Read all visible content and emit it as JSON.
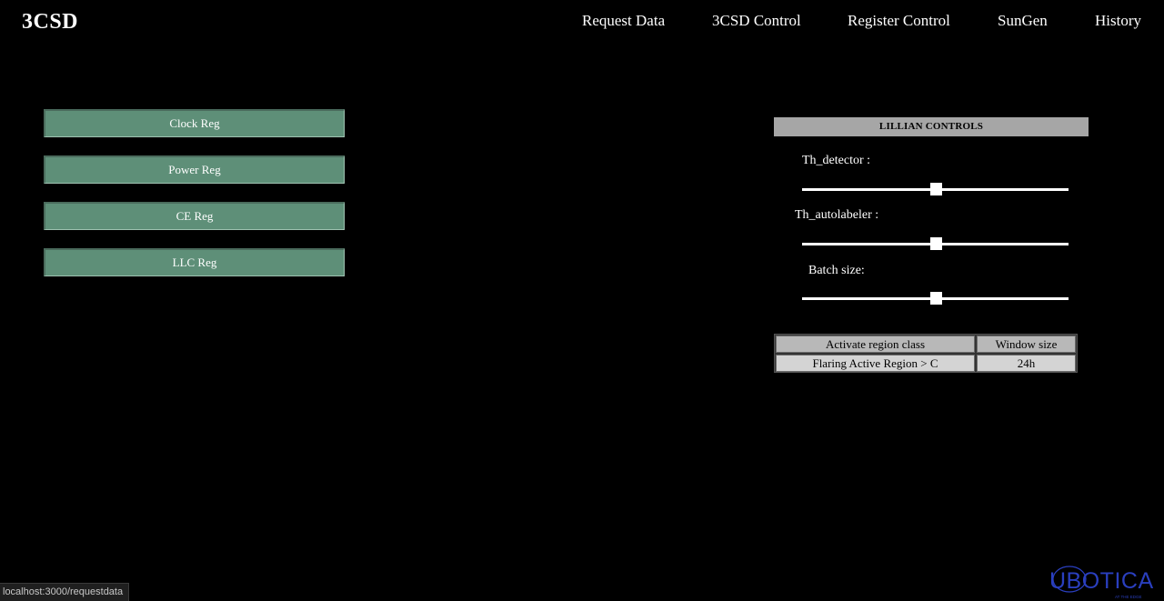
{
  "brand": {
    "title": "3CSD"
  },
  "nav": {
    "items": [
      {
        "label": "Request Data"
      },
      {
        "label": "3CSD Control"
      },
      {
        "label": "Register Control"
      },
      {
        "label": "SunGen"
      },
      {
        "label": "History"
      }
    ]
  },
  "registers": {
    "buttons": [
      {
        "label": "Clock Reg"
      },
      {
        "label": "Power Reg"
      },
      {
        "label": "CE Reg"
      },
      {
        "label": "LLC Reg"
      }
    ],
    "color": "#5e8f78"
  },
  "controls": {
    "header": "LILLIAN CONTROLS",
    "sliders": [
      {
        "label": "Th_detector :",
        "value": 0.5
      },
      {
        "label": "Th_autolabeler :",
        "value": 0.5
      },
      {
        "label": "Batch size:",
        "value": 0.5
      }
    ]
  },
  "region_table": {
    "headers": [
      "Activate region class",
      "Window size"
    ],
    "rows": [
      [
        "Flaring Active Region > C",
        "24h"
      ]
    ]
  },
  "status_bar": {
    "url": "localhost:3000/requestdata"
  },
  "logo": {
    "text": "UBOTICA",
    "tagline": "AT THE EDGE",
    "color": "#2a3fbf"
  }
}
